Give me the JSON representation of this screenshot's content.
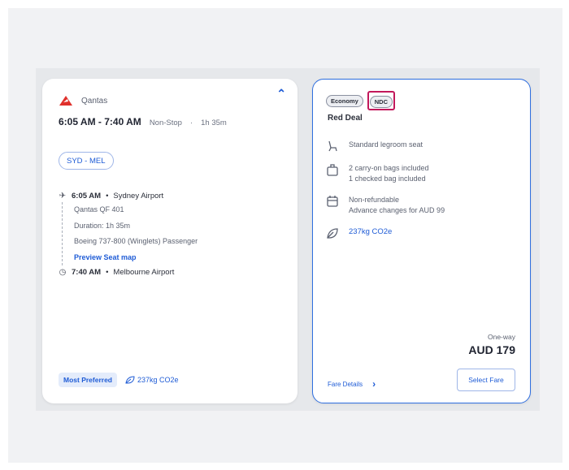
{
  "flight": {
    "airline": "Qantas",
    "times": "6:05 AM - 7:40 AM",
    "stops": "Non-Stop",
    "duration": "1h 35m",
    "route": "SYD - MEL",
    "departure": {
      "time": "6:05 AM",
      "place": "Sydney Airport"
    },
    "details": [
      "Qantas QF 401",
      "Duration: 1h 35m",
      "Boeing 737-800 (Winglets) Passenger"
    ],
    "preview_link": "Preview Seat map",
    "arrival": {
      "time": "7:40 AM",
      "place": "Melbourne Airport"
    },
    "preferred_badge": "Most Preferred",
    "co2": "237kg CO2e"
  },
  "fare": {
    "class_badge": "Economy",
    "ndc_badge": "NDC",
    "name": "Red Deal",
    "features": [
      {
        "icon": "seat-icon",
        "lines": [
          "Standard legroom seat"
        ]
      },
      {
        "icon": "baggage-icon",
        "lines": [
          "2 carry-on bags included",
          "1 checked bag included"
        ]
      },
      {
        "icon": "calendar-icon",
        "lines": [
          "Non-refundable",
          "Advance changes for AUD 99"
        ]
      },
      {
        "icon": "leaf-icon",
        "lines": [
          "237kg CO2e"
        ]
      }
    ],
    "price_label": "One-way",
    "price": "AUD 179",
    "details_link": "Fare Details",
    "select_button": "Select Fare"
  },
  "colors": {
    "accent": "#1f5cd6",
    "highlight": "#c2185b",
    "card_border": "#2f6fe0"
  }
}
